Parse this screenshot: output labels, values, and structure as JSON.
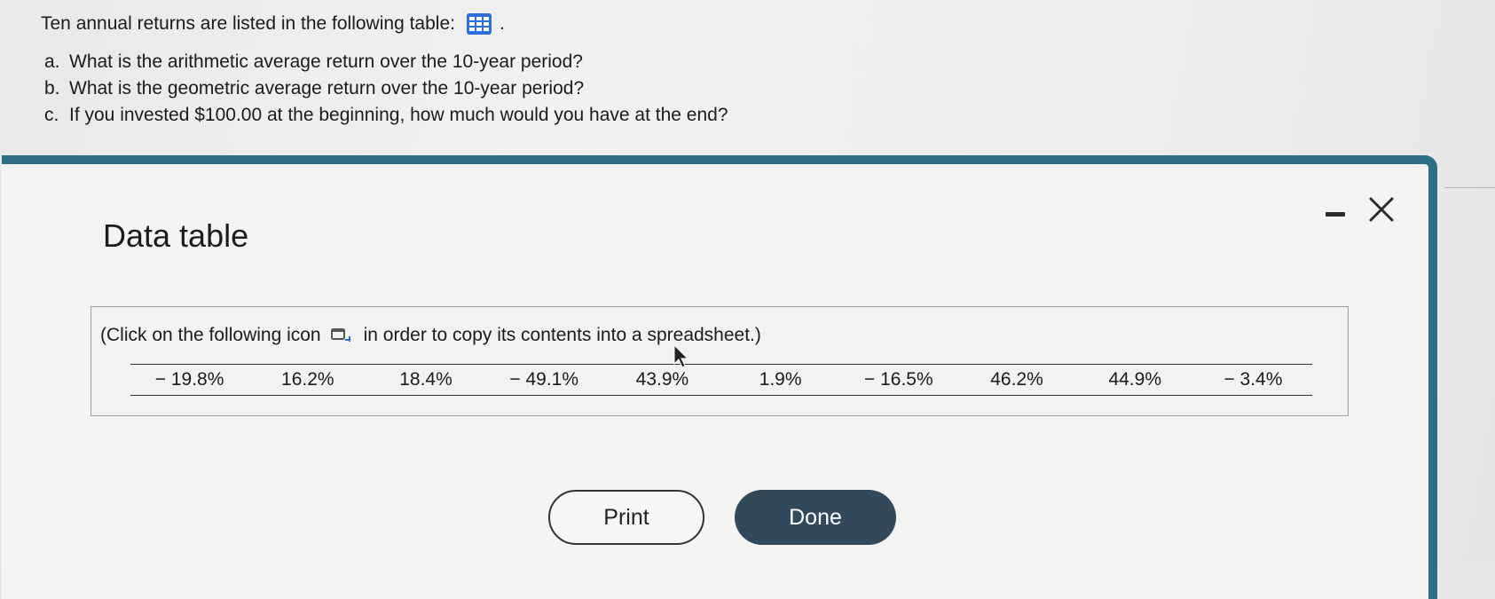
{
  "question": {
    "intro": "Ten annual returns are listed in the following table:",
    "intro_suffix": ".",
    "table_icon": "grid-table-icon",
    "items": [
      {
        "letter": "a.",
        "text": "What is the arithmetic average return over the 10-year period?"
      },
      {
        "letter": "b.",
        "text": "What is the geometric average return over the 10-year period?"
      },
      {
        "letter": "c.",
        "text": "If you invested $100.00 at the beginning, how much would you have at the end?"
      }
    ]
  },
  "modal": {
    "title": "Data table",
    "copy_note_before": "(Click on the following icon",
    "copy_note_after": "in order to copy its contents into a spreadsheet.)",
    "copy_icon": "copy-to-spreadsheet-icon",
    "returns": [
      "− 19.8%",
      "16.2%",
      "18.4%",
      "− 49.1%",
      "43.9%",
      "1.9%",
      "− 16.5%",
      "46.2%",
      "44.9%",
      "− 3.4%"
    ],
    "print_label": "Print",
    "done_label": "Done",
    "minimize_icon": "minimize-icon",
    "close_icon": "close-icon"
  },
  "colors": {
    "accent_border": "#2f6f86",
    "icon_blue": "#2a6fdb",
    "done_button": "#31495a"
  }
}
